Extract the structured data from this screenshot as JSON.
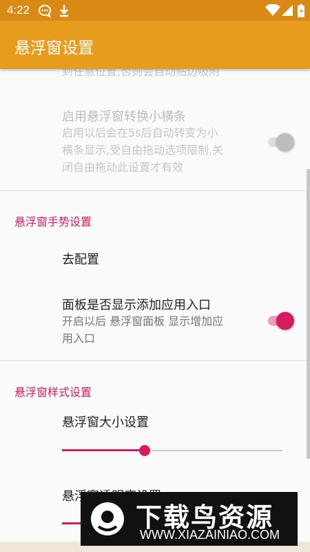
{
  "status_bar": {
    "time": "4:22",
    "left_icons": [
      "chat-bubble-icon",
      "download-icon"
    ],
    "right_icons": [
      "wifi-icon",
      "signal-icon",
      "battery-icon"
    ]
  },
  "app_bar": {
    "title": "悬浮窗设置"
  },
  "content": {
    "clipped_text": "到任意位置,否则会自动贴边吸附",
    "pref_bar_mode": {
      "title": "启用悬浮窗转换小横条",
      "summary": [
        "启用以后会在5s后自动转变为小",
        "横条显示,受自由拖动选项限制,关",
        "闭自由拖动此设置才有效"
      ],
      "enabled": false,
      "checked": true
    },
    "category_gesture": "悬浮窗手势设置",
    "pref_configure": {
      "title": "去配置"
    },
    "pref_add_app_entry": {
      "title": "面板是否显示添加应用入口",
      "summary": [
        "开启以后 悬浮窗面板 显示增加应",
        "用入口"
      ],
      "checked": true
    },
    "category_style": "悬浮窗样式设置",
    "pref_size": {
      "title": "悬浮窗大小设置",
      "value_fraction": 0.375
    },
    "pref_opacity": {
      "title": "悬浮窗透明度设置",
      "value_fraction": 0.12
    }
  },
  "watermark": {
    "big_text": "下载鸟资源",
    "url": "WWW.XIAZAINIAO.COM"
  },
  "colors": {
    "app_bar": "#e79c1e",
    "status_bar": "#d88a15",
    "accent": "#d81b60",
    "divider": "#dcdcdc"
  }
}
